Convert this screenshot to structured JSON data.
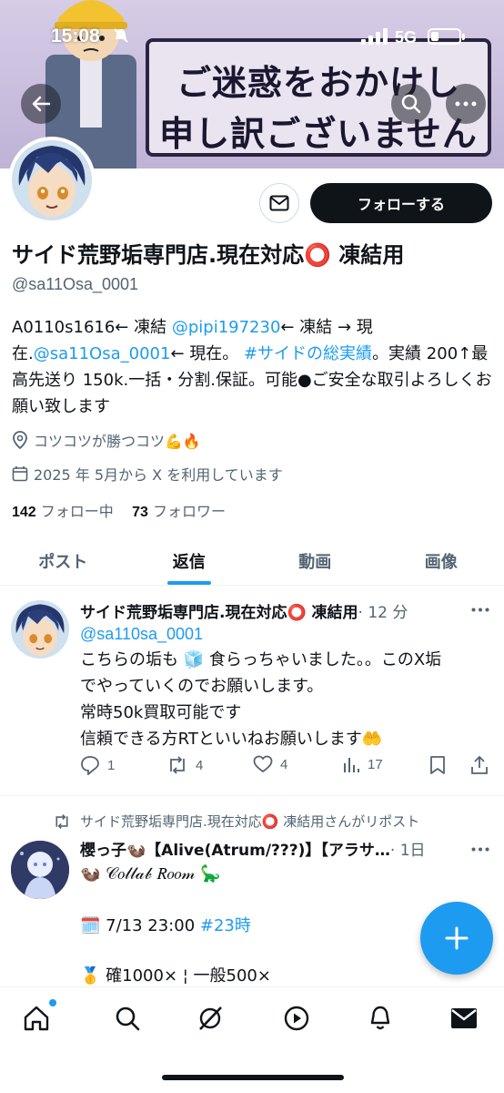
{
  "status_bar": {
    "time": "15:08",
    "network": "5G"
  },
  "banner": {
    "line1": "ご迷惑をおかけし",
    "line2": "申し訳ございません"
  },
  "profile": {
    "follow_label": "フォローする",
    "name": "サイド荒野垢専門店.現在対応⭕️ 凍結用",
    "handle": "@sa11Osa_0001",
    "bio": {
      "p1": "A0110s1616← 凍結 ",
      "link1": "@pipi197230",
      "p2": "← 凍結 → 現在.",
      "link2": "@sa11Osa_0001",
      "p3": "← 現在。 ",
      "hashtag": "#サイドの総実績",
      "p4": "。実績 200↑最高先送り 150k.一括・分割.保証。可能●ご安全な取引よろしくお願い致します"
    },
    "location": "コツコツが勝つコツ💪🔥",
    "joined": "2025 年 5月から X を利用しています",
    "following_count": "142",
    "following_label": "フォロー中",
    "followers_count": "73",
    "followers_label": "フォロワー"
  },
  "tabs": [
    {
      "label": "ポスト"
    },
    {
      "label": "返信"
    },
    {
      "label": "動画"
    },
    {
      "label": "画像"
    }
  ],
  "tweet1": {
    "name": "サイド荒野垢専門店.現在対応⭕️ 凍結用",
    "time": "· 12 分",
    "reply_handle": "@sa110sa_0001",
    "line1": "こちらの垢も 🧊 食らっちゃいました。。このX垢",
    "line2": "でやっていくのでお願いします。",
    "line3": "常時50k買取可能です",
    "line4": "信頼できる方RTといいねお願いします🤲",
    "replies": "1",
    "reposts": "4",
    "likes": "4",
    "views": "17"
  },
  "tweet2": {
    "repost_label": "サイド荒野垢専門店.現在対応⭕️ 凍結用さんがリポスト",
    "name": "櫻っ子🦦【Alive(Atrum/???)】【アラサ…",
    "time": "· 1日",
    "line1": "🦦 𝒞𝑜𝓁𝓁𝒶𝒷 𝑅𝑜𝑜𝓂 🦕",
    "line2_date": "🗓️ 7/13 23:00 ",
    "line2_tag": "#23時",
    "line3": "🥇 確1000× ¦ 一般500×"
  }
}
